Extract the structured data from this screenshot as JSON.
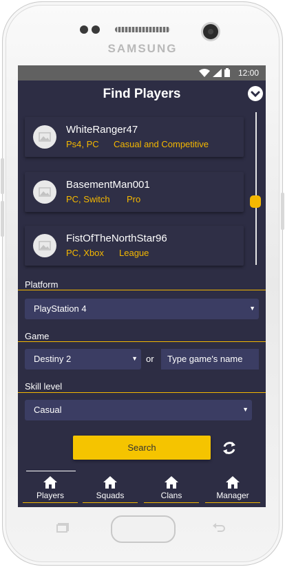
{
  "device": {
    "brand": "SAMSUNG"
  },
  "statusbar": {
    "time": "12:00"
  },
  "header": {
    "title": "Find Players"
  },
  "players": [
    {
      "name": "WhiteRanger47",
      "platforms": "Ps4, PC",
      "style": "Casual and Competitive"
    },
    {
      "name": "BasementMan001",
      "platforms": "PC, Switch",
      "style": "Pro"
    },
    {
      "name": "FistOfTheNorthStar96",
      "platforms": "PC, Xbox",
      "style": "League"
    }
  ],
  "filters": {
    "platform": {
      "label": "Platform",
      "selected": "PlayStation 4"
    },
    "game": {
      "label": "Game",
      "selected": "Destiny 2",
      "or_text": "or",
      "text_value": "Type game's name"
    },
    "skill": {
      "label": "Skill level",
      "selected": "Casual"
    }
  },
  "actions": {
    "search_label": "Search"
  },
  "tabs": [
    {
      "label": "Players",
      "icon": "home-icon"
    },
    {
      "label": "Squads",
      "icon": "home-icon"
    },
    {
      "label": "Clans",
      "icon": "home-icon"
    },
    {
      "label": "Manager",
      "icon": "home-icon"
    }
  ],
  "colors": {
    "accent": "#f5b800",
    "background": "#2d2d44",
    "field": "#3b3d63"
  }
}
